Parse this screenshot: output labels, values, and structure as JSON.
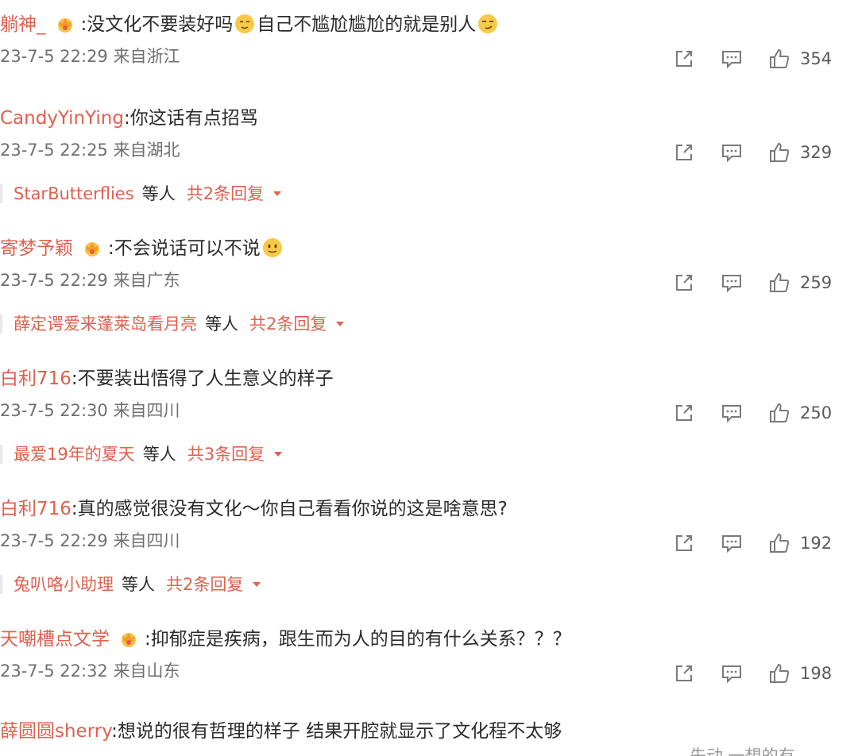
{
  "comments": [
    {
      "username": "躺神_",
      "has_badge": true,
      "separator": ":",
      "text_parts": [
        "没文化不要装好吗",
        "[emoji]",
        "自己不尴尬尴尬的就是别人",
        "[emoji]"
      ],
      "text_a": "没文化不要装好吗",
      "text_b": "自己不尴尬尴尬的就是别人",
      "date": "23-7-5 22:29",
      "location": "来自浙江",
      "likes": "354"
    },
    {
      "username": "CandyYinYing",
      "has_badge": false,
      "separator": ":",
      "text_a": "你这话有点招骂",
      "date": "23-7-5 22:25",
      "location": "来自湖北",
      "likes": "329",
      "replies": {
        "user": "StarButterflies",
        "etc": "等人",
        "count": "共2条回复"
      }
    },
    {
      "username": "寄梦予颖",
      "has_badge": true,
      "separator": ":",
      "text_a": "不会说话可以不说",
      "date": "23-7-5 22:29",
      "location": "来自广东",
      "likes": "259",
      "replies": {
        "user": "薛定谔爱来蓬莱岛看月亮",
        "etc": "等人",
        "count": "共2条回复"
      }
    },
    {
      "username": "白利716",
      "has_badge": false,
      "separator": ":",
      "text_a": "不要装出悟得了人生意义的样子",
      "date": "23-7-5 22:30",
      "location": "来自四川",
      "likes": "250",
      "replies": {
        "user": "最爱19年的夏天",
        "etc": "等人",
        "count": "共3条回复"
      }
    },
    {
      "username": "白利716",
      "has_badge": false,
      "separator": ":",
      "text_a": "真的感觉很没有文化～你自己看看你说的这是啥意思?",
      "date": "23-7-5 22:29",
      "location": "来自四川",
      "likes": "192",
      "replies": {
        "user": "兔叭咯小助理",
        "etc": "等人",
        "count": "共2条回复"
      }
    },
    {
      "username": "天嘲槽点文学",
      "has_badge": true,
      "separator": ":",
      "text_a": "抑郁症是疾病，跟生而为人的目的有什么关系？？？",
      "date": "23-7-5 22:32",
      "location": "来自山东",
      "likes": "198"
    },
    {
      "username": "薛圆圆sherry",
      "has_badge": false,
      "separator": ":",
      "text_a": "想说的很有哲理的样子 结果开腔就显示了文化程不太够"
    }
  ],
  "partial_bottom_text": "先动 一想的有",
  "icons": {
    "share": "share-icon",
    "reply": "comment-icon",
    "like": "thumbs-up-icon",
    "badge": "crown-badge-icon",
    "caret": "caret-down-icon"
  },
  "colors": {
    "username": "#e0604f",
    "text": "#2b2b2b",
    "meta": "#6f6f6f",
    "icon": "#7a7a7a"
  }
}
